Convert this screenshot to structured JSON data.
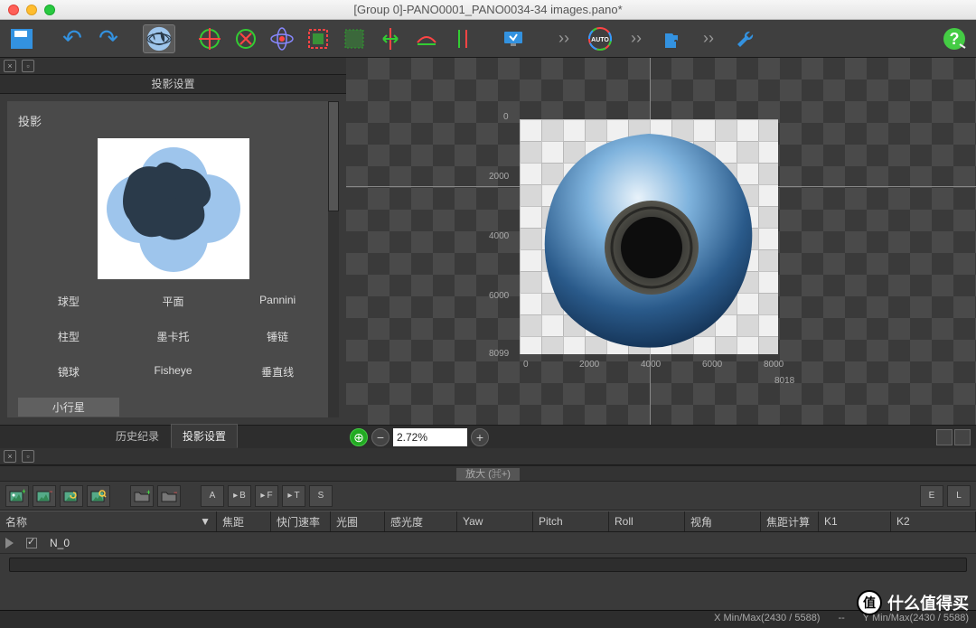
{
  "window": {
    "title": "[Group 0]-PANO0001_PANO0034-34 images.pano*"
  },
  "panel": {
    "title": "投影设置",
    "section": "投影",
    "options": [
      "球型",
      "平面",
      "Pannini",
      "柱型",
      "墨卡托",
      "锤链",
      "镜球",
      "Fisheye",
      "垂直线",
      "小行星"
    ],
    "selected": 9,
    "tabs": {
      "history": "历史纪录",
      "proj": "投影设置"
    }
  },
  "zoom": {
    "value": "2.72%"
  },
  "axis": {
    "y": [
      "0",
      "2000",
      "4000",
      "6000",
      "8099"
    ],
    "x": [
      "0",
      "2000",
      "4000",
      "6000",
      "8000"
    ],
    "xmax": "8018"
  },
  "hint": "放大 (⌘+)",
  "toolbar2": {
    "letters": [
      "A",
      "B",
      "F",
      "T",
      "S"
    ],
    "right": [
      "E",
      "L"
    ]
  },
  "columns": {
    "name": "名称",
    "focal": "焦距",
    "shutter": "快门速率",
    "aperture": "光圈",
    "iso": "感光度",
    "yaw": "Yaw",
    "pitch": "Pitch",
    "roll": "Roll",
    "fov": "视角",
    "fcalc": "焦距计算",
    "k1": "K1",
    "k2": "K2"
  },
  "row": {
    "name": "N_0"
  },
  "status": {
    "x": "X Min/Max(2430 / 5588)",
    "y": "Y Min/Max(2430 / 5588)"
  },
  "watermark": {
    "char": "值",
    "text": "什么值得买"
  }
}
